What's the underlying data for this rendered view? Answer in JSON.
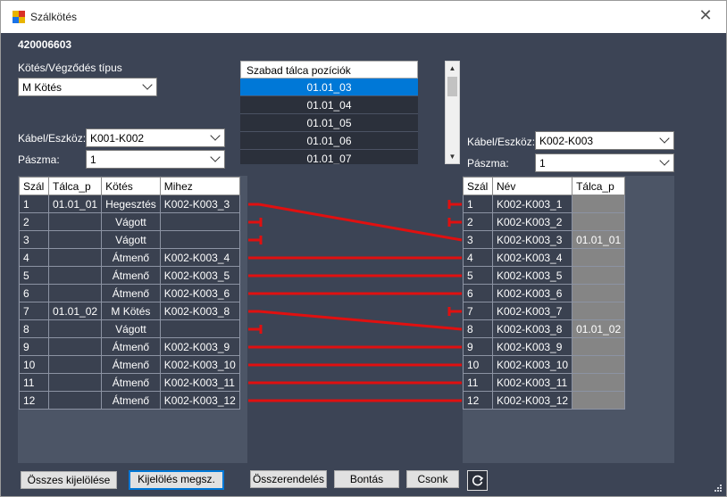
{
  "window": {
    "title": "Szálkötés"
  },
  "doc_number": "420006603",
  "left": {
    "termination_label": "Kötés/Végződés típus",
    "termination_value": "M Kötés",
    "cable_label": "Kábel/Eszköz:",
    "cable_value": "K001-K002",
    "strand_label": "Pászma:",
    "strand_value": "1",
    "columns": [
      "Szál",
      "Tálca_p",
      "Kötés",
      "Mihez"
    ],
    "rows": [
      [
        "1",
        "01.01_01",
        "Hegesztés",
        "K002-K003_3"
      ],
      [
        "2",
        "",
        "Vágott",
        ""
      ],
      [
        "3",
        "",
        "Vágott",
        ""
      ],
      [
        "4",
        "",
        "Átmenő",
        "K002-K003_4"
      ],
      [
        "5",
        "",
        "Átmenő",
        "K002-K003_5"
      ],
      [
        "6",
        "",
        "Átmenő",
        "K002-K003_6"
      ],
      [
        "7",
        "01.01_02",
        "M Kötés",
        "K002-K003_8"
      ],
      [
        "8",
        "",
        "Vágott",
        ""
      ],
      [
        "9",
        "",
        "Átmenő",
        "K002-K003_9"
      ],
      [
        "10",
        "",
        "Átmenő",
        "K002-K003_10"
      ],
      [
        "11",
        "",
        "Átmenő",
        "K002-K003_11"
      ],
      [
        "12",
        "",
        "Átmenő",
        "K002-K003_12"
      ]
    ]
  },
  "trays": {
    "header": "Szabad tálca pozíciók",
    "items": [
      "01.01_03",
      "01.01_04",
      "01.01_05",
      "01.01_06",
      "01.01_07"
    ],
    "selected": "01.01_03"
  },
  "right": {
    "cable_label": "Kábel/Eszköz:",
    "cable_value": "K002-K003",
    "strand_label": "Pászma:",
    "strand_value": "1",
    "columns": [
      "Szál",
      "Név",
      "Tálca_p"
    ],
    "rows": [
      [
        "1",
        "K002-K003_1",
        ""
      ],
      [
        "2",
        "K002-K003_2",
        ""
      ],
      [
        "3",
        "K002-K003_3",
        "01.01_01"
      ],
      [
        "4",
        "K002-K003_4",
        ""
      ],
      [
        "5",
        "K002-K003_5",
        ""
      ],
      [
        "6",
        "K002-K003_6",
        ""
      ],
      [
        "7",
        "K002-K003_7",
        ""
      ],
      [
        "8",
        "K002-K003_8",
        "01.01_02"
      ],
      [
        "9",
        "K002-K003_9",
        ""
      ],
      [
        "10",
        "K002-K003_10",
        ""
      ],
      [
        "11",
        "K002-K003_11",
        ""
      ],
      [
        "12",
        "K002-K003_12",
        ""
      ]
    ]
  },
  "connections": [
    {
      "from": 1,
      "to": 3
    },
    {
      "from": 2,
      "cut": true
    },
    {
      "from": 3,
      "cut": true
    },
    {
      "from": 4,
      "to": 4
    },
    {
      "from": 5,
      "to": 5
    },
    {
      "from": 6,
      "to": 6
    },
    {
      "from": 7,
      "to": 8
    },
    {
      "from": 8,
      "cut": true
    },
    {
      "from": 9,
      "to": 9
    },
    {
      "from": 10,
      "to": 10
    },
    {
      "from": 11,
      "to": 11
    },
    {
      "from": 12,
      "to": 12
    }
  ],
  "right_open": [
    1,
    2,
    7
  ],
  "buttons": {
    "select_all": "Összes kijelölése",
    "clear_selection": "Kijelölés megsz.",
    "connect": "Összerendelés",
    "disconnect": "Bontás",
    "splice": "Csonk"
  },
  "colors": {
    "connection_line": "#e01010",
    "selected_row": "#0078d7"
  }
}
